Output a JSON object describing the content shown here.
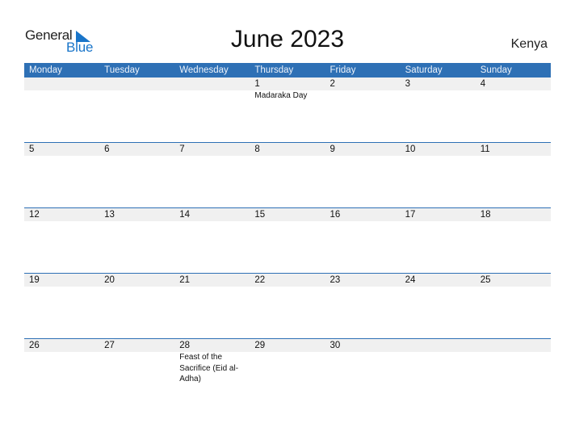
{
  "logo": {
    "general": "General",
    "blue": "Blue",
    "brand_color": "#1a75c9"
  },
  "header": {
    "title": "June 2023",
    "country": "Kenya"
  },
  "colors": {
    "header_bg": "#2e70b5",
    "date_strip_bg": "#f0f0f0"
  },
  "weekdays": [
    "Monday",
    "Tuesday",
    "Wednesday",
    "Thursday",
    "Friday",
    "Saturday",
    "Sunday"
  ],
  "weeks": [
    {
      "days": [
        {
          "num": "",
          "event": ""
        },
        {
          "num": "",
          "event": ""
        },
        {
          "num": "",
          "event": ""
        },
        {
          "num": "1",
          "event": "Madaraka Day"
        },
        {
          "num": "2",
          "event": ""
        },
        {
          "num": "3",
          "event": ""
        },
        {
          "num": "4",
          "event": ""
        }
      ]
    },
    {
      "days": [
        {
          "num": "5",
          "event": ""
        },
        {
          "num": "6",
          "event": ""
        },
        {
          "num": "7",
          "event": ""
        },
        {
          "num": "8",
          "event": ""
        },
        {
          "num": "9",
          "event": ""
        },
        {
          "num": "10",
          "event": ""
        },
        {
          "num": "11",
          "event": ""
        }
      ]
    },
    {
      "days": [
        {
          "num": "12",
          "event": ""
        },
        {
          "num": "13",
          "event": ""
        },
        {
          "num": "14",
          "event": ""
        },
        {
          "num": "15",
          "event": ""
        },
        {
          "num": "16",
          "event": ""
        },
        {
          "num": "17",
          "event": ""
        },
        {
          "num": "18",
          "event": ""
        }
      ]
    },
    {
      "days": [
        {
          "num": "19",
          "event": ""
        },
        {
          "num": "20",
          "event": ""
        },
        {
          "num": "21",
          "event": ""
        },
        {
          "num": "22",
          "event": ""
        },
        {
          "num": "23",
          "event": ""
        },
        {
          "num": "24",
          "event": ""
        },
        {
          "num": "25",
          "event": ""
        }
      ]
    },
    {
      "days": [
        {
          "num": "26",
          "event": ""
        },
        {
          "num": "27",
          "event": ""
        },
        {
          "num": "28",
          "event": "Feast of the Sacrifice (Eid al-Adha)"
        },
        {
          "num": "29",
          "event": ""
        },
        {
          "num": "30",
          "event": ""
        },
        {
          "num": "",
          "event": ""
        },
        {
          "num": "",
          "event": ""
        }
      ]
    }
  ]
}
